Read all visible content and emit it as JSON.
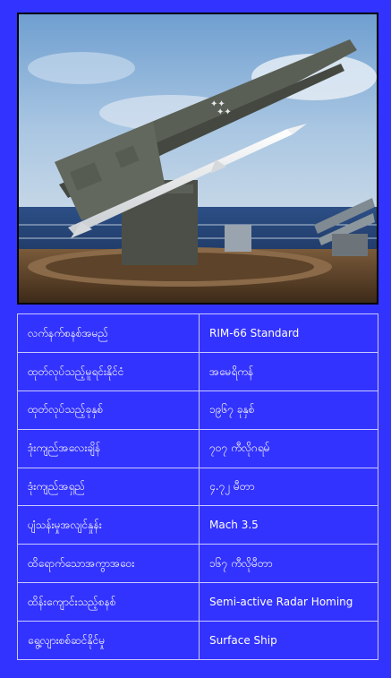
{
  "photo": {
    "icon": "missile-launcher-photo"
  },
  "specs": {
    "rows": [
      {
        "label": "လက်နက်စနစ်အမည်",
        "value": "RIM-66 Standard"
      },
      {
        "label": "ထုတ်လုပ်သည့်မူရင်းနိုင်ငံ",
        "value": "အမေရိကန်"
      },
      {
        "label": "ထုတ်လုပ်သည့်ခုနှစ်",
        "value": "၁၉၆၇ ခုနှစ်"
      },
      {
        "label": "ဒုံးကျည်အလေးချိန်",
        "value": "၇၀၇ ကီလိုဂရမ်"
      },
      {
        "label": "ဒုံးကျည်အရှည်",
        "value": "၄.၇၂ မီတာ"
      },
      {
        "label": "ပျံသန်းမှုအလျင်နှုန်း",
        "value": "Mach 3.5"
      },
      {
        "label": "ထိရောက်သောအကွာအဝေး",
        "value": "၁၆၇ ကီလိုမီတာ"
      },
      {
        "label": "ထိန်းကျောင်းသည့်စနစ်",
        "value": "Semi-active Radar Homing"
      },
      {
        "label": "ရွေ့လျားစစ်ဆင်နိုင်မှု",
        "value": "Surface Ship"
      }
    ]
  }
}
